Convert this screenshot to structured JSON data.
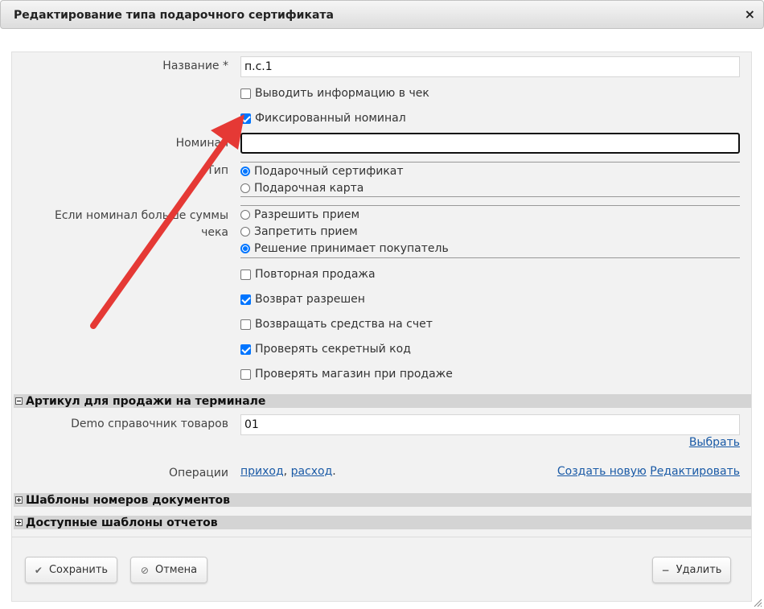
{
  "dialog": {
    "title": "Редактирование типа подарочного сертификата",
    "close_symbol": "×"
  },
  "form": {
    "name_label": "Название *",
    "name_value": "п.с.1",
    "print_info_label": "Выводить информацию в чек",
    "print_info_checked": false,
    "fixed_nominal_label": "Фиксированный номинал",
    "fixed_nominal_checked": true,
    "nominal_label": "Номинал",
    "nominal_value": "",
    "type_label": "Тип",
    "type_options": [
      {
        "label": "Подарочный сертификат",
        "checked": true
      },
      {
        "label": "Подарочная карта",
        "checked": false
      }
    ],
    "overflow_label_line1": "Если номинал больше суммы",
    "overflow_label_line2": "чека",
    "overflow_options": [
      {
        "label": "Разрешить прием",
        "checked": false
      },
      {
        "label": "Запретить прием",
        "checked": false
      },
      {
        "label": "Решение принимает покупатель",
        "checked": true
      }
    ],
    "checkboxes": [
      {
        "label": "Повторная продажа",
        "checked": false
      },
      {
        "label": "Возврат разрешен",
        "checked": true
      },
      {
        "label": "Возвращать средства на счет",
        "checked": false
      },
      {
        "label": "Проверять секретный код",
        "checked": true
      },
      {
        "label": "Проверять магазин при продаже",
        "checked": false
      }
    ]
  },
  "terminal_section": {
    "title": "Артикул для продажи на терминале",
    "expanded": true,
    "catalog_label": "Demo справочник товаров",
    "catalog_value": "01",
    "select_link": "Выбрать",
    "operations_label": "Операции",
    "op_income": "приход",
    "op_comma": ",",
    "op_expense": "расход",
    "op_dot": ".",
    "create_link": "Создать новую",
    "edit_link": "Редактировать"
  },
  "doc_templates_section": {
    "title": "Шаблоны номеров документов",
    "expanded": false
  },
  "report_templates_section": {
    "title": "Доступные шаблоны отчетов",
    "expanded": false
  },
  "buttons": {
    "save": "Сохранить",
    "cancel": "Отмена",
    "delete": "Удалить"
  },
  "icons": {
    "save": "check-icon",
    "cancel": "cancel-icon",
    "delete": "minus-icon"
  },
  "colors": {
    "accent": "#0075ff",
    "link": "#1a5aa6",
    "annotation_arrow": "#e53935"
  }
}
